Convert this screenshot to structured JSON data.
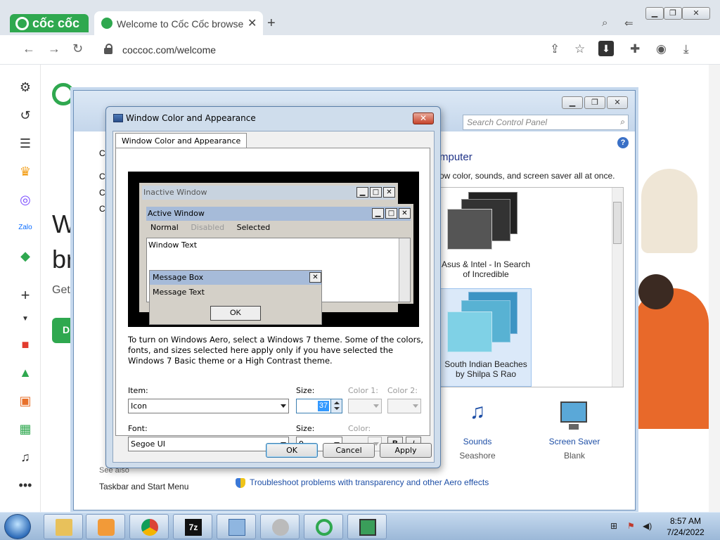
{
  "browser": {
    "brand_text": "cốc cốc",
    "tab_title": "Welcome to Cốc Cốc browse",
    "url": "coccoc.com/welcome"
  },
  "page": {
    "heading_partial_1": "W",
    "heading_partial_2": "br",
    "get_partial": "Get",
    "download_partial": "Di"
  },
  "control_panel": {
    "search_placeholder": "Search Control Panel",
    "heading_partial": "mputer",
    "subtitle_partial": "ow color, sounds, and screen saver all at once.",
    "themes": [
      {
        "name": "Asus & Intel - In Search of Incredible"
      },
      {
        "name": "South Indian Beaches by Shilpa S Rao"
      }
    ],
    "sounds_label": "Sounds",
    "sounds_value": "Seashore",
    "screensaver_label": "Screen Saver",
    "screensaver_value": "Blank",
    "see_also": "See also",
    "taskbar_link": "Taskbar and Start Menu",
    "trouble_link": "Troubleshoot problems with transparency and other Aero effects",
    "left_partial": [
      "C",
      "C",
      "C",
      "C"
    ]
  },
  "dialog": {
    "title": "Window Color and Appearance",
    "tab": "Window Color and Appearance",
    "preview": {
      "inactive": "Inactive Window",
      "active": "Active Window",
      "menu_normal": "Normal",
      "menu_disabled": "Disabled",
      "menu_selected": "Selected",
      "window_text": "Window Text",
      "msgbox_title": "Message Box",
      "msgbox_text": "Message Text",
      "ok": "OK"
    },
    "description": "To turn on Windows Aero, select a Windows 7 theme.  Some of the colors, fonts, and sizes selected here apply only if you have selected the Windows 7 Basic theme or a High Contrast theme.",
    "item_label": "Item:",
    "item_value": "Icon",
    "size_label": "Size:",
    "size_value": "37",
    "color1_label": "Color 1:",
    "color2_label": "Color 2:",
    "font_label": "Font:",
    "font_value": "Segoe UI",
    "font_size_label": "Size:",
    "font_size_value": "9",
    "color_label": "Color:",
    "bold": "B",
    "italic": "I",
    "ok": "OK",
    "cancel": "Cancel",
    "apply": "Apply"
  },
  "taskbar": {
    "time": "8:57 AM",
    "date": "7/24/2022",
    "apps": [
      "explorer",
      "media-player",
      "chrome",
      "7zip",
      "control-panel",
      "speaker",
      "coccoc",
      "monitor"
    ]
  },
  "colors": {
    "coccoc_green": "#2fa84f",
    "active_title": "#a6bbd9",
    "inactive_title": "#c8d3df",
    "link_blue": "#1e4fa6"
  }
}
